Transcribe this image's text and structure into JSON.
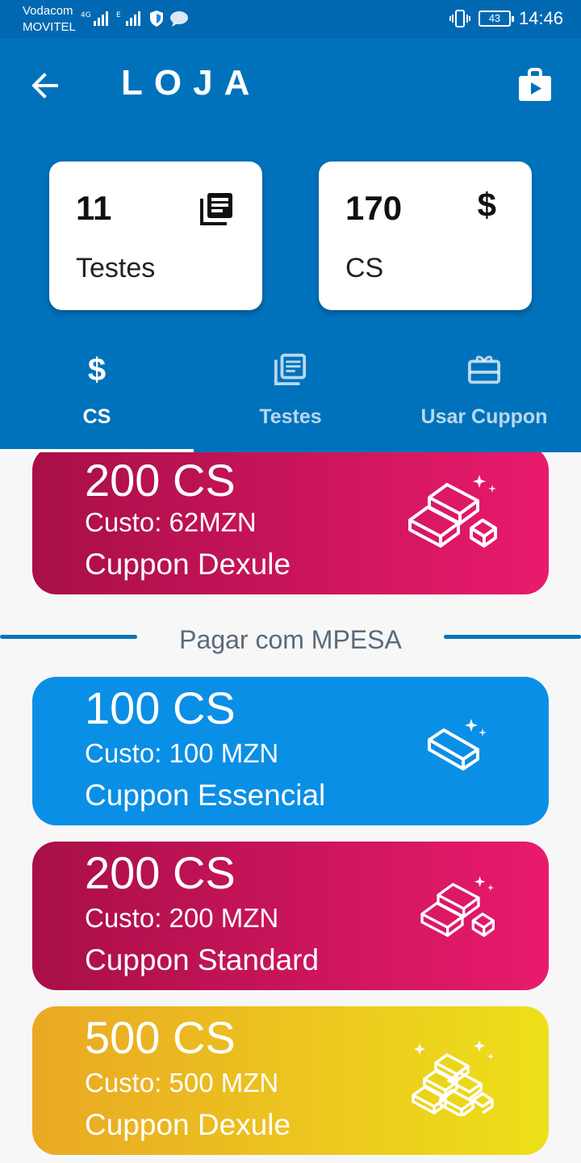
{
  "status_bar": {
    "carrier_1": "Vodacom",
    "carrier_2": "MOVITEL",
    "network_1": "4G",
    "network_2": "E",
    "battery": "43",
    "time": "14:46"
  },
  "header": {
    "title": "LOJA",
    "back_icon": "arrow-back-icon",
    "store_icon": "play-store-bag-icon"
  },
  "stats": [
    {
      "value": "11",
      "label": "Testes",
      "icon": "library-books-icon"
    },
    {
      "value": "170",
      "label": "CS",
      "icon": "dollar-icon",
      "symbol": "$"
    }
  ],
  "tabs": [
    {
      "label": "CS",
      "icon": "dollar-icon",
      "symbol": "$",
      "active": true
    },
    {
      "label": "Testes",
      "icon": "library-books-icon",
      "active": false
    },
    {
      "label": "Usar Cuppon",
      "icon": "gift-card-icon",
      "active": false
    }
  ],
  "cards_top": [
    {
      "amount": "200 CS",
      "cost": "Custo: 62MZN",
      "name": "Cuppon Dexule",
      "color": "#c8145a",
      "icon": "gold-bars-3-icon"
    }
  ],
  "divider_label": "Pagar com MPESA",
  "cards_mpesa": [
    {
      "amount": "100 CS",
      "cost": "Custo: 100 MZN",
      "name": "Cuppon Essencial",
      "color": "#0a8fe6",
      "icon": "gold-bar-1-icon"
    },
    {
      "amount": "200 CS",
      "cost": "Custo: 200 MZN",
      "name": "Cuppon Standard",
      "color": "#c8145a",
      "icon": "gold-bars-3-icon"
    },
    {
      "amount": "500 CS",
      "cost": "Custo: 500 MZN",
      "name": "Cuppon Dexule",
      "color": "#ebc320",
      "icon": "gold-bars-6-icon"
    }
  ]
}
